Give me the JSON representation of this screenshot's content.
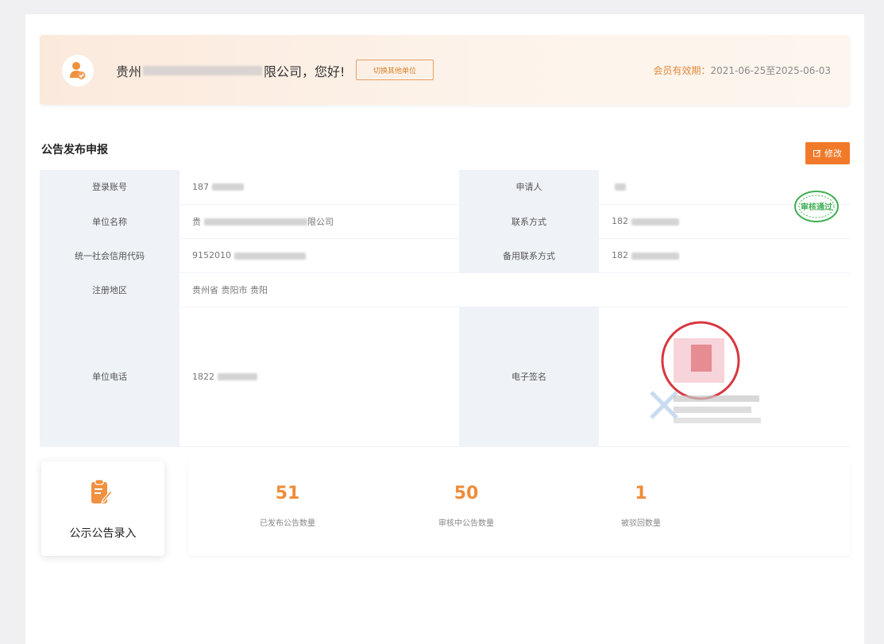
{
  "banner": {
    "company_prefix": "贵州",
    "company_suffix": "限公司，您好!",
    "switch_button": "切换其他单位",
    "member_label": "会员有效期：",
    "member_period": "2021-06-25至2025-06-03"
  },
  "section": {
    "title": "公告发布申报",
    "edit_button": "修改"
  },
  "info": {
    "login_account_label": "登录账号",
    "login_account_value": "187",
    "applicant_label": "申请人",
    "applicant_value": "",
    "unit_name_label": "单位名称",
    "unit_name_value": "贵",
    "unit_name_suffix": "限公司",
    "contact_label": "联系方式",
    "contact_value": "182",
    "credit_code_label": "统一社会信用代码",
    "credit_code_value": "9152010",
    "backup_contact_label": "备用联系方式",
    "backup_contact_value": "182",
    "region_label": "注册地区",
    "region_value": "贵州省 贵阳市 贵阳",
    "phone_label": "单位电话",
    "phone_value": "1822",
    "esign_label": "电子签名"
  },
  "stamp": {
    "approved_text": "审核通过"
  },
  "entry": {
    "label": "公示公告录入",
    "icon": "clipboard-edit-icon"
  },
  "stats": [
    {
      "value": "51",
      "label": "已发布公告数量"
    },
    {
      "value": "50",
      "label": "审核中公告数量"
    },
    {
      "value": "1",
      "label": "被驳回数量"
    }
  ],
  "colors": {
    "accent": "#ef8c3a",
    "edit_button": "#f07a2a",
    "stamp_green": "#3fae52",
    "seal_red": "#d8373f"
  }
}
